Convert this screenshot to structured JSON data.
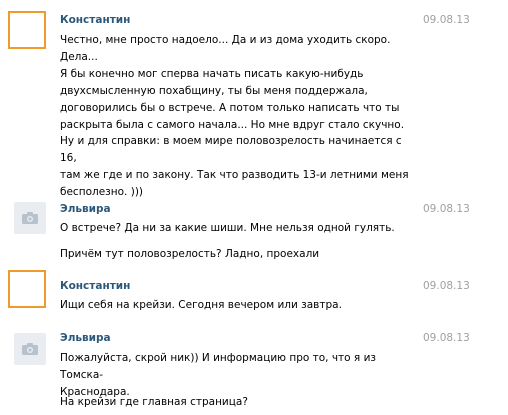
{
  "messages": [
    {
      "author": "Константин",
      "date": "09.08.13",
      "avatar": "orange-frame-avatar",
      "paragraphs": [
        "Честно, мне просто надоело... Да и из дома уходить скоро. Дела...\nЯ бы конечно мог сперва начать писать какую-нибудь\nдвухсмысленную похабщину, ты бы меня поддержала,\nдоговорились бы о встрече. А потом только написать что ты\nраскрыта была с самого начала... Но мне вдруг стало скучно.",
        "Ну и для справки: в моем мире половозрелость начинается с 16,\nтам же где и по закону. Так что разводить 13-и летними меня\nбесполезно. )))"
      ]
    },
    {
      "author": "Эльвира",
      "date": "09.08.13",
      "avatar": "camera-icon",
      "paragraphs": [
        "О встрече? Да ни за какие шиши. Мне нельзя одной гулять.",
        "Причём тут половозрелость? Ладно, проехали"
      ]
    },
    {
      "author": "Константин",
      "date": "09.08.13",
      "avatar": "orange-frame-avatar",
      "paragraphs": [
        "Ищи себя на крейзи. Сегодня вечером или завтра."
      ]
    },
    {
      "author": "Эльвира",
      "date": "09.08.13",
      "avatar": "camera-icon",
      "paragraphs": [
        "Пожалуйста, скрой ник)) И информацию про то, что я из Томска-\nКраснодара.",
        "На крейзи где главная страница?"
      ]
    }
  ]
}
